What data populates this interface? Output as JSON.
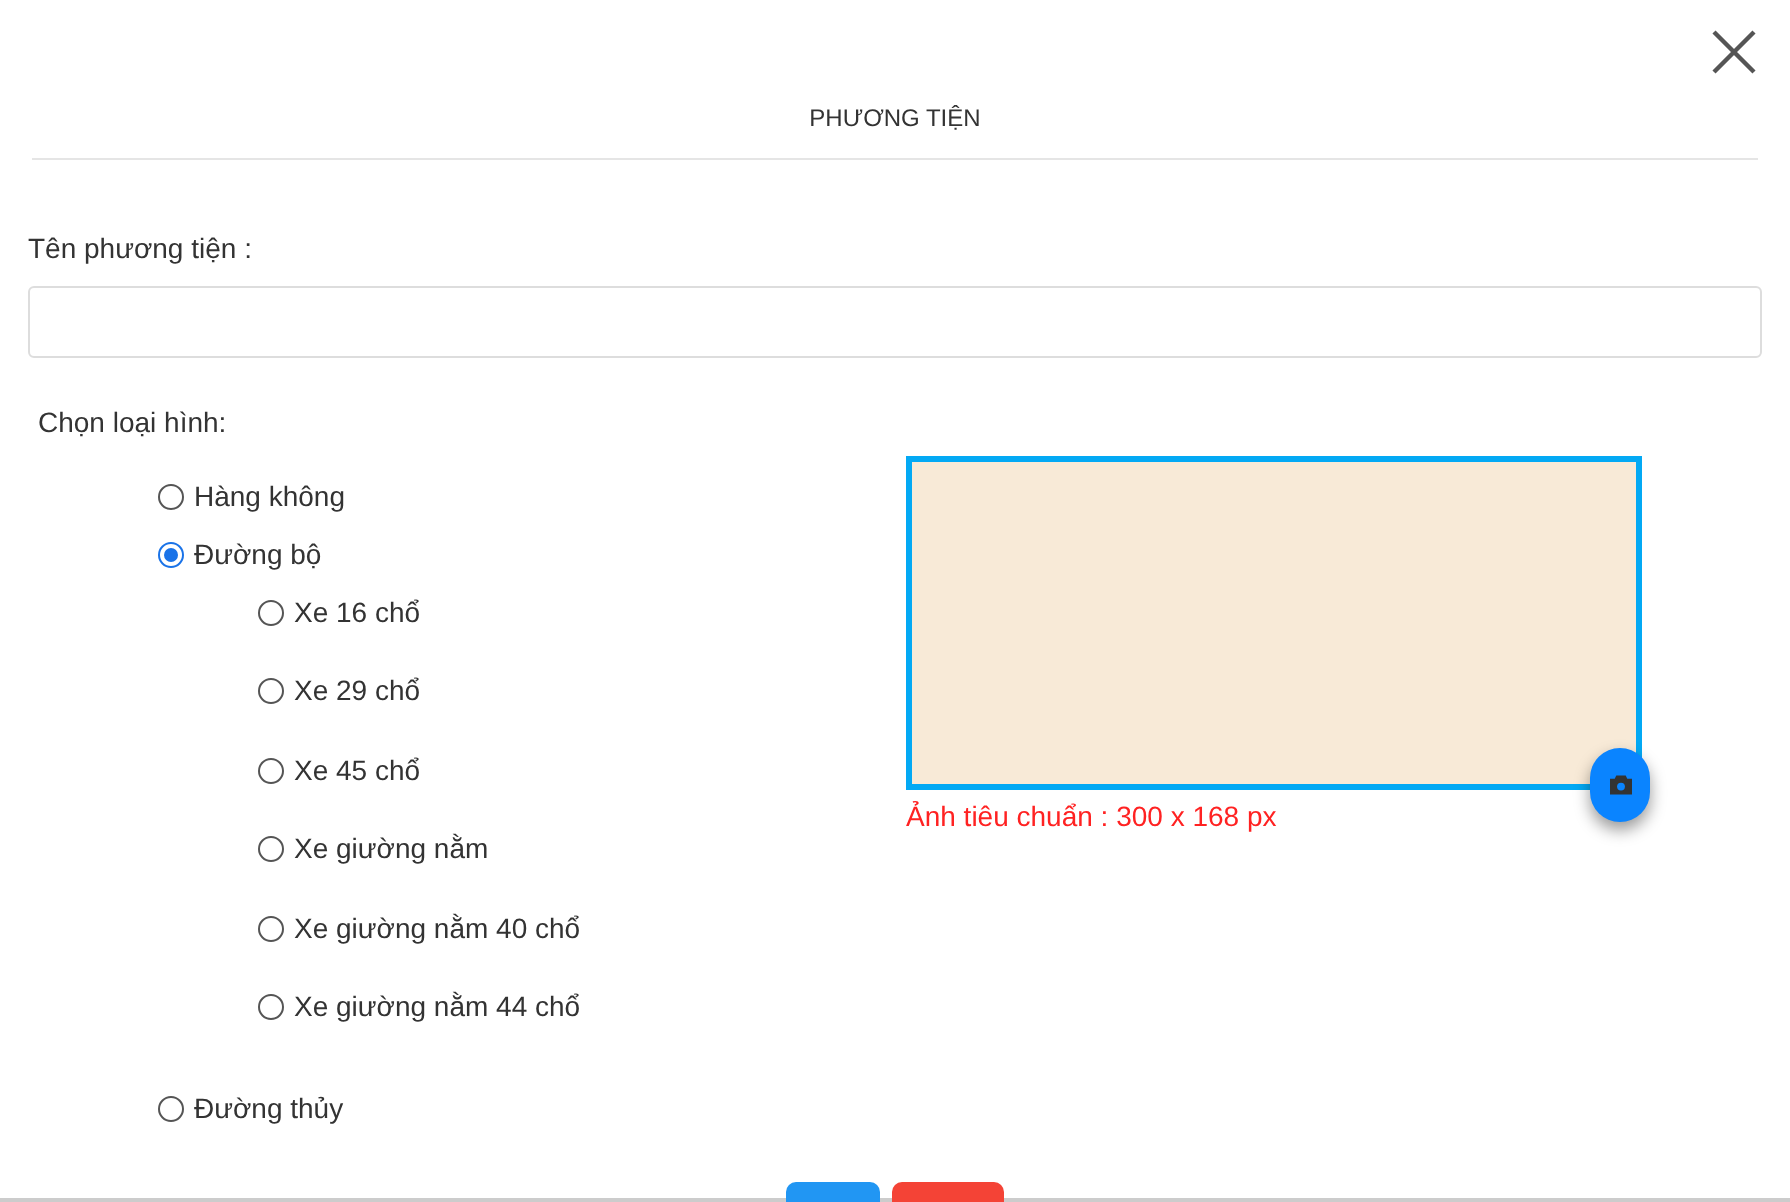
{
  "dialog": {
    "title": "PHƯƠNG TIỆN"
  },
  "name_field": {
    "label": "Tên phương tiện :"
  },
  "type_group": {
    "label": "Chọn loại hình:",
    "options": [
      {
        "label": "Hàng không",
        "selected": false
      },
      {
        "label": "Đường bộ",
        "selected": true,
        "children": [
          {
            "label": "Xe 16 chổ",
            "selected": false
          },
          {
            "label": "Xe 29 chổ",
            "selected": false
          },
          {
            "label": "Xe 45 chổ",
            "selected": false
          },
          {
            "label": "Xe giường nằm",
            "selected": false
          },
          {
            "label": "Xe giường nằm 40 chổ",
            "selected": false
          },
          {
            "label": "Xe giường nằm 44 chổ",
            "selected": false
          }
        ]
      },
      {
        "label": "Đường thủy",
        "selected": false
      }
    ]
  },
  "image_upload": {
    "note": "Ảnh tiêu chuẩn : 300 x 168 px"
  },
  "footer_buttons": [
    {
      "kind": "primary"
    },
    {
      "kind": "danger"
    }
  ]
}
